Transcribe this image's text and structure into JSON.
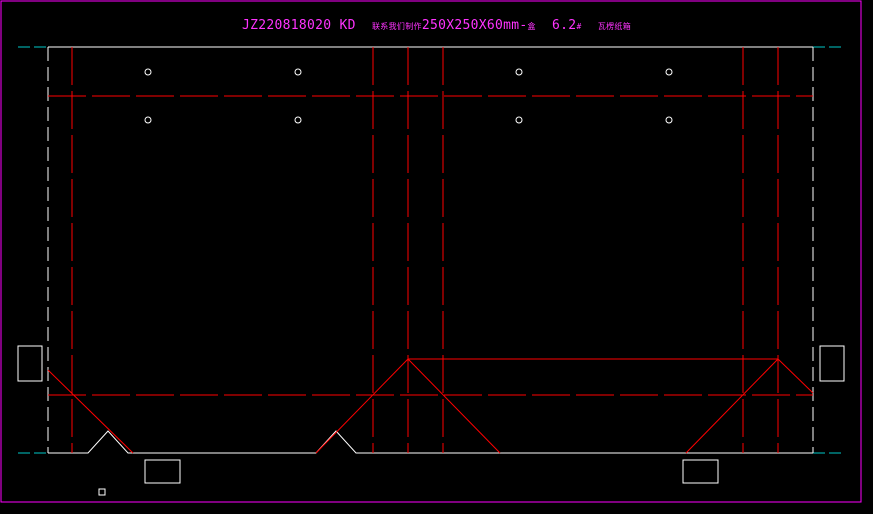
{
  "title": {
    "code": "JZ220818020 KD",
    "desc_cjk": "联系我们制作",
    "size": "250X250X60mm-",
    "size_suffix_cjk": "盒",
    "thickness": "6.2",
    "thickness_suffix_cjk": "#",
    "note_cjk": "瓦楞纸箱"
  },
  "colors": {
    "background": "#000000",
    "frame": "#ff00ff",
    "cut_line": "#ffffff",
    "fold_line": "#ff0000",
    "guide_line": "#00c8c8",
    "title_text": "#ff33ff"
  },
  "legend": {
    "cut": "white solid = cut line",
    "fold": "red dashed = crease line"
  }
}
